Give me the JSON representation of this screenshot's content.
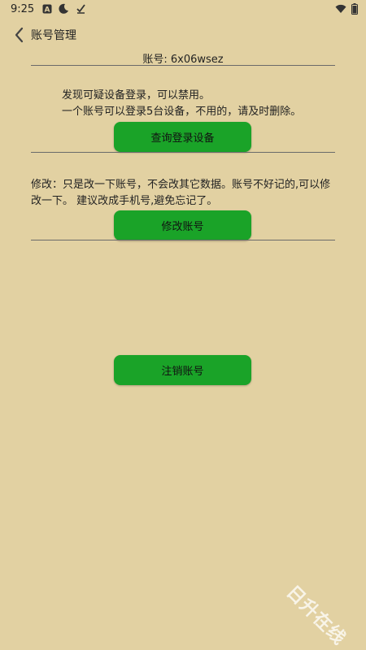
{
  "status_bar": {
    "time": "9:25",
    "left_icons": [
      "a-icon",
      "night-mode-icon",
      "check-icon"
    ],
    "right_icons": [
      "wifi-icon",
      "battery-icon"
    ]
  },
  "header": {
    "title": "账号管理"
  },
  "account": {
    "label": "账号:",
    "value": "6x06wsez"
  },
  "devices_section": {
    "line1": "发现可疑设备登录，可以禁用。",
    "line2": "一个账号可以登录5台设备，不用的，请及时删除。",
    "button": "查询登录设备"
  },
  "modify_section": {
    "line1": "修改：只是改一下账号，不会改其它数据。账号不好记的,可以修",
    "line2": "改一下。 建议改成手机号,避免忘记了。",
    "button": "修改账号"
  },
  "cancel_section": {
    "button": "注销账号"
  },
  "watermark": "日升在线",
  "colors": {
    "background": "#e2d1a2",
    "button": "#1aa328"
  }
}
